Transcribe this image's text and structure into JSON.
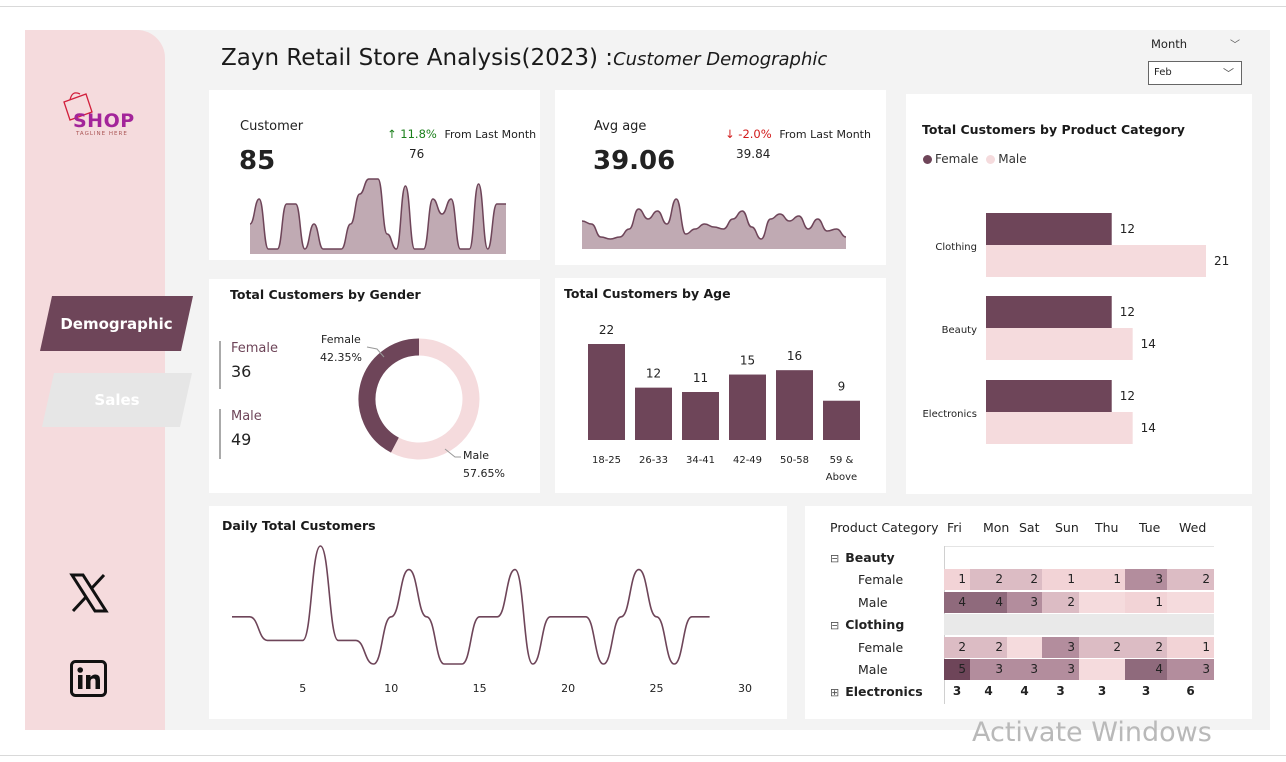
{
  "page_title": "Zayn Retail Store Analysis(2023)",
  "page_subtitle": "Customer Demographic",
  "slicer": {
    "label": "Month",
    "value": "Feb"
  },
  "logo": {
    "text": "SHOP",
    "tagline": "TAGLINE HERE"
  },
  "nav": {
    "demographic": "Demographic",
    "sales": "Sales"
  },
  "social": {
    "x": "x-icon",
    "linkedin": "linkedin-icon"
  },
  "colors": {
    "primary": "#6e4559",
    "light": "#f5dbdd",
    "green": "#1a7f1a",
    "red": "#d11a1a"
  },
  "kpi_customer": {
    "label": "Customer",
    "value": "85",
    "delta": "↑ 11.8%",
    "delta_label": "From Last Month",
    "prev": "76",
    "spark": [
      30,
      55,
      5,
      5,
      50,
      50,
      5,
      30,
      5,
      5,
      5,
      30,
      60,
      75,
      75,
      20,
      5,
      68,
      5,
      5,
      55,
      40,
      55,
      5,
      5,
      70,
      5,
      50,
      50
    ]
  },
  "kpi_age": {
    "label": "Avg age",
    "value": "39.06",
    "delta": "↓ -2.0%",
    "delta_label": "From Last Month",
    "prev": "39.84",
    "spark": [
      28,
      25,
      12,
      10,
      12,
      20,
      40,
      30,
      38,
      25,
      50,
      15,
      20,
      25,
      22,
      20,
      30,
      38,
      22,
      10,
      30,
      35,
      28,
      33,
      20,
      30,
      18,
      20,
      12
    ]
  },
  "gender_card": {
    "title": "Total Customers by Gender",
    "female_label": "Female",
    "female_value": "36",
    "male_label": "Male",
    "male_value": "49",
    "donut_female_label": "Female",
    "donut_female_pct": "42.35%",
    "donut_male_label": "Male",
    "donut_male_pct": "57.65%"
  },
  "age_card": {
    "title": "Total Customers by Age"
  },
  "category_card": {
    "title": "Total Customers by Product Category",
    "legend_female": "Female",
    "legend_male": "Male"
  },
  "daily_card": {
    "title": "Daily Total Customers",
    "x_ticks": [
      "5",
      "10",
      "15",
      "20",
      "25",
      "30"
    ]
  },
  "matrix": {
    "header": "Product Category",
    "days": [
      "Fri",
      "Mon",
      "Sat",
      "Sun",
      "Thu",
      "Tue",
      "Wed"
    ],
    "rows": [
      {
        "label": "Beauty",
        "type": "group",
        "toggle": "⊟",
        "cells": [
          "",
          "",
          "",
          "",
          "",
          "",
          ""
        ]
      },
      {
        "label": "Female",
        "type": "child",
        "cells": [
          "1",
          "2",
          "2",
          "1",
          "1",
          "3",
          "2"
        ]
      },
      {
        "label": "Male",
        "type": "child",
        "cells": [
          "4",
          "4",
          "3",
          "2",
          "",
          "1",
          ""
        ]
      },
      {
        "label": "Clothing",
        "type": "group",
        "toggle": "⊟",
        "cells": [
          "",
          "",
          "",
          "",
          "",
          "",
          ""
        ]
      },
      {
        "label": "Female",
        "type": "child",
        "cells": [
          "2",
          "2",
          "",
          "3",
          "2",
          "2",
          "1"
        ]
      },
      {
        "label": "Male",
        "type": "child",
        "cells": [
          "5",
          "3",
          "3",
          "3",
          "",
          "4",
          "3"
        ]
      },
      {
        "label": "Electronics",
        "type": "total",
        "toggle": "⊞",
        "cells": [
          "3",
          "4",
          "4",
          "3",
          "3",
          "3",
          "6"
        ]
      }
    ]
  },
  "watermark": "Activate Windows",
  "chart_data": [
    {
      "type": "bar",
      "title": "Total Customers by Age",
      "categories": [
        "18-25",
        "26-33",
        "34-41",
        "42-49",
        "50-58",
        "59 & Above"
      ],
      "values": [
        22,
        12,
        11,
        15,
        16,
        9
      ],
      "ylim": [
        0,
        22
      ]
    },
    {
      "type": "bar",
      "title": "Total Customers by Product Category",
      "categories": [
        "Clothing",
        "Beauty",
        "Electronics"
      ],
      "series": [
        {
          "name": "Female",
          "values": [
            12,
            12,
            12
          ]
        },
        {
          "name": "Male",
          "values": [
            21,
            14,
            14
          ]
        }
      ],
      "xlim": [
        0,
        21
      ]
    },
    {
      "type": "pie",
      "title": "Total Customers by Gender",
      "categories": [
        "Female",
        "Male"
      ],
      "values": [
        36,
        49
      ]
    },
    {
      "type": "line",
      "title": "Daily Total Customers",
      "x": [
        1,
        2,
        3,
        4,
        5,
        6,
        7,
        8,
        9,
        10,
        11,
        12,
        13,
        14,
        15,
        16,
        17,
        18,
        19,
        20,
        21,
        22,
        23,
        24,
        25,
        26,
        27,
        28
      ],
      "y": [
        3,
        3,
        2,
        2,
        2,
        6,
        2,
        2,
        1,
        3,
        5,
        3,
        1,
        1,
        3,
        3,
        5,
        1,
        3,
        3,
        3,
        1,
        3,
        5,
        3,
        1,
        3,
        3
      ],
      "xlim": [
        1,
        30
      ],
      "x_ticks": [
        5,
        10,
        15,
        20,
        25,
        30
      ]
    }
  ]
}
